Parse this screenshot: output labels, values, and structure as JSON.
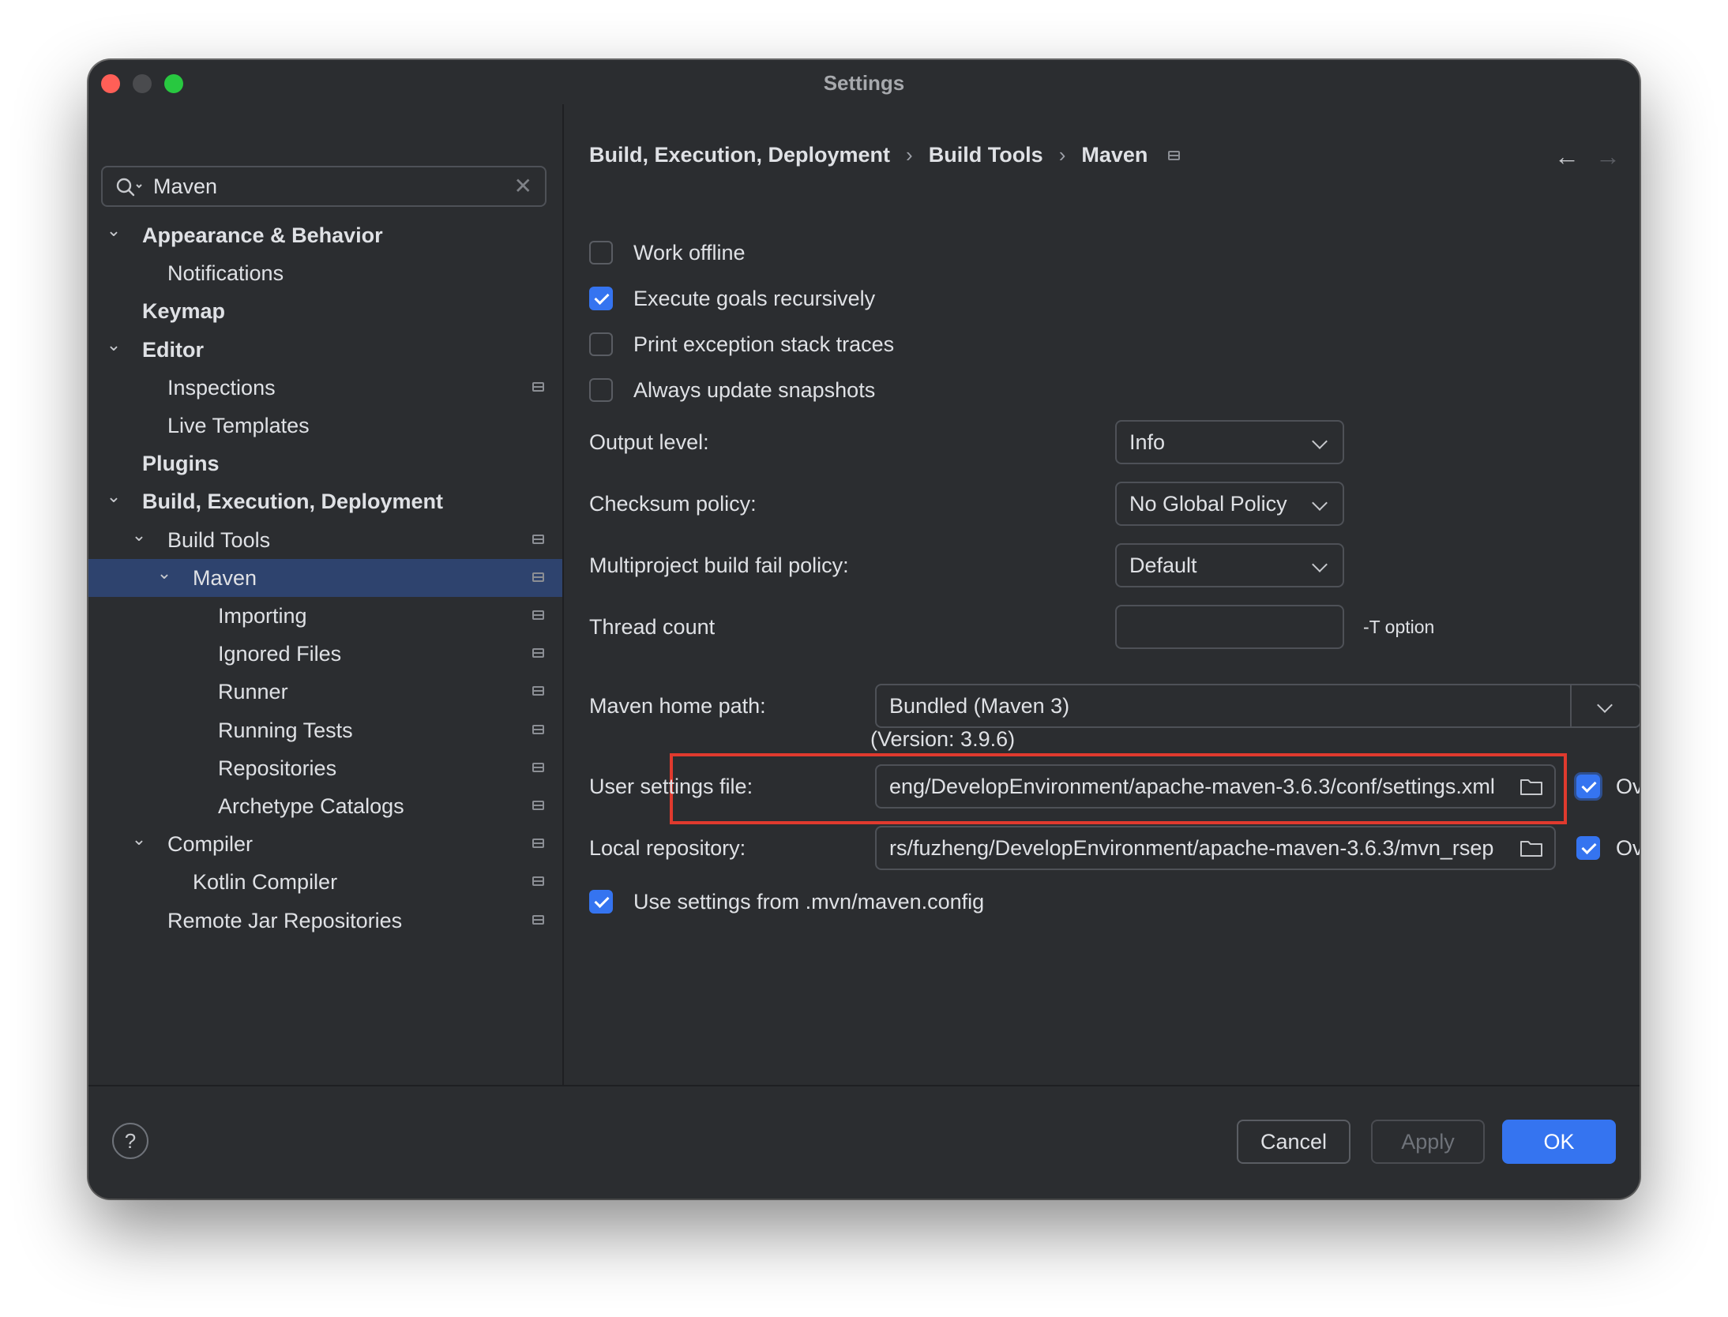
{
  "window": {
    "title": "Settings"
  },
  "search": {
    "value": "Maven"
  },
  "tree": [
    {
      "label": "Appearance & Behavior",
      "bold": true,
      "expanded": true,
      "depth": 0
    },
    {
      "label": "Notifications",
      "bold": false,
      "depth": 1
    },
    {
      "label": "Keymap",
      "bold": true,
      "depth": 0
    },
    {
      "label": "Editor",
      "bold": true,
      "expanded": true,
      "depth": 0
    },
    {
      "label": "Inspections",
      "bold": false,
      "depth": 1,
      "project_icon": true
    },
    {
      "label": "Live Templates",
      "bold": false,
      "depth": 1
    },
    {
      "label": "Plugins",
      "bold": true,
      "depth": 0
    },
    {
      "label": "Build, Execution, Deployment",
      "bold": true,
      "expanded": true,
      "depth": 0
    },
    {
      "label": "Build Tools",
      "bold": false,
      "expanded": true,
      "depth": 1,
      "project_icon": true
    },
    {
      "label": "Maven",
      "bold": false,
      "expanded": true,
      "depth": 2,
      "project_icon": true,
      "selected": true
    },
    {
      "label": "Importing",
      "bold": false,
      "depth": 3,
      "project_icon": true
    },
    {
      "label": "Ignored Files",
      "bold": false,
      "depth": 3,
      "project_icon": true
    },
    {
      "label": "Runner",
      "bold": false,
      "depth": 3,
      "project_icon": true
    },
    {
      "label": "Running Tests",
      "bold": false,
      "depth": 3,
      "project_icon": true
    },
    {
      "label": "Repositories",
      "bold": false,
      "depth": 3,
      "project_icon": true
    },
    {
      "label": "Archetype Catalogs",
      "bold": false,
      "depth": 3,
      "project_icon": true
    },
    {
      "label": "Compiler",
      "bold": false,
      "expanded": true,
      "depth": 1,
      "project_icon": true
    },
    {
      "label": "Kotlin Compiler",
      "bold": false,
      "depth": 2,
      "project_icon": true
    },
    {
      "label": "Remote Jar Repositories",
      "bold": false,
      "depth": 1,
      "project_icon": true
    }
  ],
  "breadcrumb": {
    "part1": "Build, Execution, Deployment",
    "part2": "Build Tools",
    "part3": "Maven",
    "separator": "›"
  },
  "checkboxes": {
    "work_offline": {
      "label": "Work offline",
      "checked": false
    },
    "execute_goals": {
      "label": "Execute goals recursively",
      "checked": true
    },
    "print_exception": {
      "label": "Print exception stack traces",
      "checked": false
    },
    "always_update": {
      "label": "Always update snapshots",
      "checked": false
    },
    "use_mvn_config": {
      "label": "Use settings from .mvn/maven.config",
      "checked": true
    }
  },
  "form": {
    "output_level": {
      "label": "Output level:",
      "value": "Info"
    },
    "checksum_policy": {
      "label": "Checksum policy:",
      "value": "No Global Policy"
    },
    "multiproject_policy": {
      "label": "Multiproject build fail policy:",
      "value": "Default"
    },
    "thread_count": {
      "label": "Thread count",
      "value": "",
      "hint": "-T option"
    },
    "maven_home": {
      "label": "Maven home path:",
      "value": "Bundled (Maven 3)",
      "browse_label": "...",
      "version": "(Version: 3.9.6)"
    },
    "user_settings": {
      "label": "User settings file:",
      "value": "eng/DevelopEnvironment/apache-maven-3.6.3/conf/settings.xml",
      "override_label": "Override",
      "override_checked": true
    },
    "local_repo": {
      "label": "Local repository:",
      "value": "rs/fuzheng/DevelopEnvironment/apache-maven-3.6.3/mvn_rsep",
      "override_label": "Override",
      "override_checked": true
    }
  },
  "footer": {
    "help_label": "?",
    "cancel_label": "Cancel",
    "apply_label": "Apply",
    "ok_label": "OK"
  },
  "colors": {
    "accent": "#3574f0",
    "background": "#2b2d30",
    "selection": "#2e436e",
    "highlight_border": "#e03a2e"
  }
}
